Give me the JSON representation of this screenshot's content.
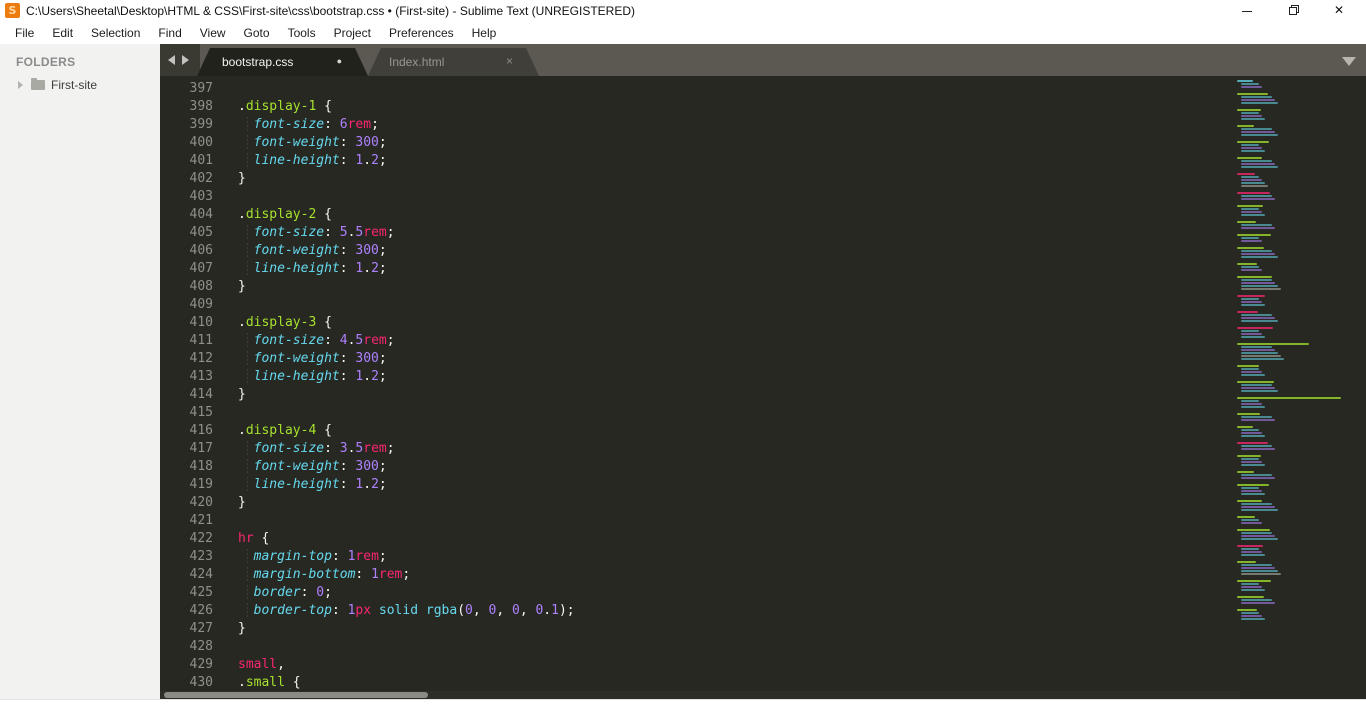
{
  "window": {
    "title": "C:\\Users\\Sheetal\\Desktop\\HTML & CSS\\First-site\\css\\bootstrap.css • (First-site) - Sublime Text (UNREGISTERED)",
    "app_icon_letter": "S",
    "controls": [
      "minimize-icon",
      "restore-icon",
      "close-icon"
    ]
  },
  "icons": {
    "window_close": "✕",
    "tab_close": "×",
    "modified_dot": "●"
  },
  "menu": {
    "items": [
      "File",
      "Edit",
      "Selection",
      "Find",
      "View",
      "Goto",
      "Tools",
      "Project",
      "Preferences",
      "Help"
    ]
  },
  "sidebar": {
    "header": "FOLDERS",
    "folders": [
      {
        "name": "First-site"
      }
    ]
  },
  "tabs": [
    {
      "label": "bootstrap.css",
      "active": true,
      "modified": true
    },
    {
      "label": "Index.html",
      "active": false,
      "modified": false
    }
  ],
  "colors": {
    "editor_bg": "#272822",
    "gutter": "#8f9089",
    "plain": "#f8f8f2",
    "selector_class": "#a6e22e",
    "selector_element": "#f92672",
    "property": "#66d9ef",
    "number": "#ae81ff",
    "unit": "#f92672",
    "keyword_value": "#66d9ef",
    "tabbar_bg": "#5b5952",
    "active_tab_bg": "#21221c",
    "sidebar_bg": "#f2f2f1",
    "minimap_green": "#a6e22e",
    "minimap_pink": "#f92672",
    "minimap_cyan": "#66d9ef",
    "minimap_purple": "#ae81ff"
  },
  "editor": {
    "first_line": 397,
    "last_line": 430,
    "lines": [
      [],
      [
        [
          ".",
          "w"
        ],
        [
          "display-1",
          "g"
        ],
        [
          " {",
          "w"
        ]
      ],
      [
        [
          "  ",
          "w"
        ],
        [
          "font-size",
          "c"
        ],
        [
          ": ",
          "w"
        ],
        [
          "6",
          "n"
        ],
        [
          "rem",
          "p"
        ],
        [
          ";",
          "w"
        ]
      ],
      [
        [
          "  ",
          "w"
        ],
        [
          "font-weight",
          "c"
        ],
        [
          ": ",
          "w"
        ],
        [
          "300",
          "n"
        ],
        [
          ";",
          "w"
        ]
      ],
      [
        [
          "  ",
          "w"
        ],
        [
          "line-height",
          "c"
        ],
        [
          ": ",
          "w"
        ],
        [
          "1",
          "n"
        ],
        [
          ".",
          "w"
        ],
        [
          "2",
          "n"
        ],
        [
          ";",
          "w"
        ]
      ],
      [
        [
          "}",
          "w"
        ]
      ],
      [],
      [
        [
          ".",
          "w"
        ],
        [
          "display-2",
          "g"
        ],
        [
          " {",
          "w"
        ]
      ],
      [
        [
          "  ",
          "w"
        ],
        [
          "font-size",
          "c"
        ],
        [
          ": ",
          "w"
        ],
        [
          "5",
          "n"
        ],
        [
          ".",
          "w"
        ],
        [
          "5",
          "n"
        ],
        [
          "rem",
          "p"
        ],
        [
          ";",
          "w"
        ]
      ],
      [
        [
          "  ",
          "w"
        ],
        [
          "font-weight",
          "c"
        ],
        [
          ": ",
          "w"
        ],
        [
          "300",
          "n"
        ],
        [
          ";",
          "w"
        ]
      ],
      [
        [
          "  ",
          "w"
        ],
        [
          "line-height",
          "c"
        ],
        [
          ": ",
          "w"
        ],
        [
          "1",
          "n"
        ],
        [
          ".",
          "w"
        ],
        [
          "2",
          "n"
        ],
        [
          ";",
          "w"
        ]
      ],
      [
        [
          "}",
          "w"
        ]
      ],
      [],
      [
        [
          ".",
          "w"
        ],
        [
          "display-3",
          "g"
        ],
        [
          " {",
          "w"
        ]
      ],
      [
        [
          "  ",
          "w"
        ],
        [
          "font-size",
          "c"
        ],
        [
          ": ",
          "w"
        ],
        [
          "4",
          "n"
        ],
        [
          ".",
          "w"
        ],
        [
          "5",
          "n"
        ],
        [
          "rem",
          "p"
        ],
        [
          ";",
          "w"
        ]
      ],
      [
        [
          "  ",
          "w"
        ],
        [
          "font-weight",
          "c"
        ],
        [
          ": ",
          "w"
        ],
        [
          "300",
          "n"
        ],
        [
          ";",
          "w"
        ]
      ],
      [
        [
          "  ",
          "w"
        ],
        [
          "line-height",
          "c"
        ],
        [
          ": ",
          "w"
        ],
        [
          "1",
          "n"
        ],
        [
          ".",
          "w"
        ],
        [
          "2",
          "n"
        ],
        [
          ";",
          "w"
        ]
      ],
      [
        [
          "}",
          "w"
        ]
      ],
      [],
      [
        [
          ".",
          "w"
        ],
        [
          "display-4",
          "g"
        ],
        [
          " {",
          "w"
        ]
      ],
      [
        [
          "  ",
          "w"
        ],
        [
          "font-size",
          "c"
        ],
        [
          ": ",
          "w"
        ],
        [
          "3",
          "n"
        ],
        [
          ".",
          "w"
        ],
        [
          "5",
          "n"
        ],
        [
          "rem",
          "p"
        ],
        [
          ";",
          "w"
        ]
      ],
      [
        [
          "  ",
          "w"
        ],
        [
          "font-weight",
          "c"
        ],
        [
          ": ",
          "w"
        ],
        [
          "300",
          "n"
        ],
        [
          ";",
          "w"
        ]
      ],
      [
        [
          "  ",
          "w"
        ],
        [
          "line-height",
          "c"
        ],
        [
          ": ",
          "w"
        ],
        [
          "1",
          "n"
        ],
        [
          ".",
          "w"
        ],
        [
          "2",
          "n"
        ],
        [
          ";",
          "w"
        ]
      ],
      [
        [
          "}",
          "w"
        ]
      ],
      [],
      [
        [
          "hr",
          "p"
        ],
        [
          " {",
          "w"
        ]
      ],
      [
        [
          "  ",
          "w"
        ],
        [
          "margin-top",
          "c"
        ],
        [
          ": ",
          "w"
        ],
        [
          "1",
          "n"
        ],
        [
          "rem",
          "p"
        ],
        [
          ";",
          "w"
        ]
      ],
      [
        [
          "  ",
          "w"
        ],
        [
          "margin-bottom",
          "c"
        ],
        [
          ": ",
          "w"
        ],
        [
          "1",
          "n"
        ],
        [
          "rem",
          "p"
        ],
        [
          ";",
          "w"
        ]
      ],
      [
        [
          "  ",
          "w"
        ],
        [
          "border",
          "c"
        ],
        [
          ": ",
          "w"
        ],
        [
          "0",
          "n"
        ],
        [
          ";",
          "w"
        ]
      ],
      [
        [
          "  ",
          "w"
        ],
        [
          "border-top",
          "c"
        ],
        [
          ": ",
          "w"
        ],
        [
          "1",
          "n"
        ],
        [
          "px",
          "p"
        ],
        [
          " ",
          "w"
        ],
        [
          "solid",
          "k"
        ],
        [
          " ",
          "w"
        ],
        [
          "rgba",
          "k"
        ],
        [
          "(",
          "w"
        ],
        [
          "0",
          "n"
        ],
        [
          ", ",
          "w"
        ],
        [
          "0",
          "n"
        ],
        [
          ", ",
          "w"
        ],
        [
          "0",
          "n"
        ],
        [
          ", ",
          "w"
        ],
        [
          "0",
          "n"
        ],
        [
          ".",
          "w"
        ],
        [
          "1",
          "n"
        ],
        [
          ");",
          "w"
        ]
      ],
      [
        [
          "}",
          "w"
        ]
      ],
      [],
      [
        [
          "small",
          "p"
        ],
        [
          ",",
          "w"
        ]
      ],
      [
        [
          ".",
          "w"
        ],
        [
          "small",
          "g"
        ],
        [
          " {",
          "w"
        ]
      ]
    ]
  },
  "minimap": {
    "blocks": [
      [
        "c",
        2
      ],
      [
        "g",
        3
      ],
      [
        "g",
        3
      ],
      [
        "g",
        3
      ],
      [
        "g",
        3
      ],
      [
        "g",
        3
      ],
      [
        "p",
        4
      ],
      [
        "p",
        2
      ],
      [
        "g",
        3
      ],
      [
        "g",
        2
      ],
      [
        "g",
        2
      ],
      [
        "g",
        3
      ],
      [
        "g",
        2
      ],
      [
        "g",
        4
      ],
      [
        "p",
        3
      ],
      [
        "p",
        3
      ],
      [
        "p",
        3
      ],
      [
        "g",
        5,
        72
      ],
      [
        "g",
        3
      ],
      [
        "g",
        3
      ],
      [
        "g",
        3,
        104
      ],
      [
        "g",
        2
      ],
      [
        "g",
        3
      ],
      [
        "p",
        2
      ],
      [
        "g",
        3
      ],
      [
        "g",
        2
      ],
      [
        "g",
        3
      ],
      [
        "g",
        3
      ],
      [
        "g",
        2
      ],
      [
        "g",
        3
      ],
      [
        "p",
        3
      ],
      [
        "g",
        4
      ],
      [
        "g",
        3
      ],
      [
        "g",
        2
      ],
      [
        "g",
        3
      ]
    ]
  }
}
